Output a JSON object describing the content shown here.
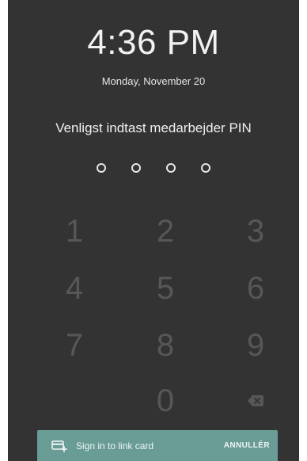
{
  "lock_screen": {
    "time": "4:36 PM",
    "date": "Monday, November 20",
    "prompt": "Venligst indtast medarbejder PIN",
    "pin_length": 4,
    "pin_entered": 0
  },
  "keypad": {
    "keys": [
      "1",
      "2",
      "3",
      "4",
      "5",
      "6",
      "7",
      "8",
      "9",
      "0"
    ],
    "backspace_icon": "backspace-icon"
  },
  "snackbar": {
    "icon": "card-plus-icon",
    "message": "Sign in to link card",
    "action_label": "ANNULLÉR"
  },
  "colors": {
    "background": "#333333",
    "keypad_digit": "#575757",
    "snackbar": "#6a9c96"
  }
}
